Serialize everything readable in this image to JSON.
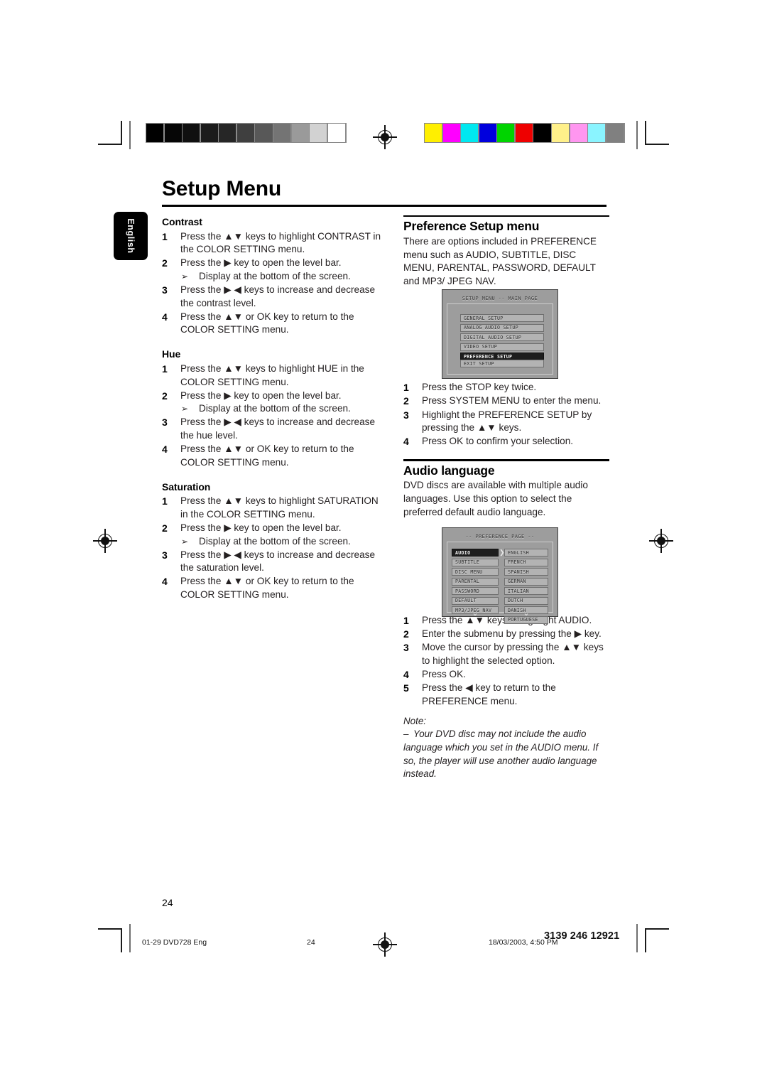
{
  "document": {
    "title": "Setup Menu",
    "language_tab": "English",
    "page_number": "24"
  },
  "left_column": {
    "sections": [
      {
        "heading": "Contrast",
        "steps": [
          {
            "n": "1",
            "text": "Press the ▲▼ keys to highlight CONTRAST in the COLOR SETTING menu."
          },
          {
            "n": "2",
            "text": "Press the ▶ key to open the level bar.",
            "sub": "Display at the bottom of the screen."
          },
          {
            "n": "3",
            "text": "Press the ▶ ◀ keys to increase and decrease the contrast level."
          },
          {
            "n": "4",
            "text": "Press the ▲▼ or OK key to return to the COLOR SETTING menu."
          }
        ]
      },
      {
        "heading": "Hue",
        "steps": [
          {
            "n": "1",
            "text": "Press the ▲▼ keys to highlight HUE in the COLOR SETTING menu."
          },
          {
            "n": "2",
            "text": "Press the ▶ key to open the level bar.",
            "sub": "Display at the bottom of the screen."
          },
          {
            "n": "3",
            "text": "Press the ▶ ◀ keys to increase and decrease the hue level."
          },
          {
            "n": "4",
            "text": "Press the ▲▼ or OK key to return to the COLOR SETTING menu."
          }
        ]
      },
      {
        "heading": "Saturation",
        "steps": [
          {
            "n": "1",
            "text": "Press the ▲▼ keys to highlight SATURATION in the COLOR SETTING menu."
          },
          {
            "n": "2",
            "text": "Press the ▶ key to open the level bar.",
            "sub": "Display at the bottom of the screen."
          },
          {
            "n": "3",
            "text": "Press the ▶ ◀ keys to increase and decrease the saturation level."
          },
          {
            "n": "4",
            "text": "Press the ▲▼ or OK key to return to the COLOR SETTING menu."
          }
        ]
      }
    ]
  },
  "right_column": {
    "preference": {
      "heading": "Preference Setup menu",
      "body": "There are options included in PREFERENCE menu such as AUDIO, SUBTITLE, DISC MENU, PARENTAL, PASSWORD,  DEFAULT and MP3/ JPEG NAV.",
      "steps": [
        {
          "n": "1",
          "text": "Press the STOP key twice."
        },
        {
          "n": "2",
          "text": "Press SYSTEM MENU to enter the menu."
        },
        {
          "n": "3",
          "text": "Highlight the PREFERENCE SETUP by pressing the ▲▼ keys."
        },
        {
          "n": "4",
          "text": "Press OK to confirm your selection."
        }
      ]
    },
    "audio_language": {
      "heading": "Audio language",
      "body": "DVD discs are available with multiple audio languages. Use this option to select the preferred default audio language.",
      "steps": [
        {
          "n": "1",
          "text": "Press the ▲▼ keys to highlight AUDIO."
        },
        {
          "n": "2",
          "text": "Enter the submenu by pressing the ▶  key."
        },
        {
          "n": "3",
          "text": "Move the cursor by pressing the ▲▼ keys to highlight the selected option."
        },
        {
          "n": "4",
          "text": "Press OK."
        },
        {
          "n": "5",
          "text": "Press the ◀ key to return to the PREFERENCE menu."
        }
      ],
      "note_label": "Note:",
      "note_text": "Your DVD disc may not include the audio language which you set in the AUDIO menu. If so, the player will use another audio language instead."
    }
  },
  "screenshot_main": {
    "title": "SETUP MENU -- MAIN PAGE",
    "items": [
      {
        "label": "GENERAL SETUP",
        "selected": false
      },
      {
        "label": "ANALOG AUDIO SETUP",
        "selected": false
      },
      {
        "label": "DIGITAL AUDIO SETUP",
        "selected": false
      },
      {
        "label": "VIDEO SETUP",
        "selected": false
      },
      {
        "label": "PREFERENCE SETUP",
        "selected": true
      }
    ],
    "exit": {
      "label": "EXIT SETUP",
      "selected": false
    }
  },
  "screenshot_preference": {
    "title": "-- PREFERENCE PAGE --",
    "left_items": [
      {
        "label": "AUDIO",
        "selected": true
      },
      {
        "label": "SUBTITLE",
        "selected": false
      },
      {
        "label": "DISC MENU",
        "selected": false
      },
      {
        "label": "PARENTAL",
        "selected": false
      },
      {
        "label": "PASSWORD",
        "selected": false
      },
      {
        "label": "DEFAULT",
        "selected": false
      },
      {
        "label": "MP3/JPEG NAV",
        "selected": false
      }
    ],
    "right_items": [
      {
        "label": "ENGLISH",
        "selected": false
      },
      {
        "label": "FRENCH",
        "selected": false
      },
      {
        "label": "SPANISH",
        "selected": false
      },
      {
        "label": "GERMAN",
        "selected": false
      },
      {
        "label": "ITALIAN",
        "selected": false
      },
      {
        "label": "DUTCH",
        "selected": false
      },
      {
        "label": "DANISH",
        "selected": false
      },
      {
        "label": "PORTUGUESE",
        "selected": false
      }
    ],
    "scroll_down_glyph": "⌄",
    "cursor_glyph": "❯"
  },
  "footer": {
    "left": "01-29 DVD728 Eng",
    "center": "24",
    "date": "18/03/2003, 4:50 PM",
    "code": "3139 246 12921"
  },
  "calibration": {
    "grayscale": [
      "#000000",
      "#060606",
      "#101010",
      "#1b1b1b",
      "#262626",
      "#3f3f3f",
      "#585858",
      "#747474",
      "#9a9a9a",
      "#d2d2d2",
      "#ffffff"
    ],
    "colorbar": [
      "#ffef00",
      "#ff00ff",
      "#00e8f0",
      "#0000dd",
      "#00d400",
      "#ee0000",
      "#000000",
      "#fff08a",
      "#ff96f0",
      "#8af4ff",
      "#808080"
    ]
  }
}
